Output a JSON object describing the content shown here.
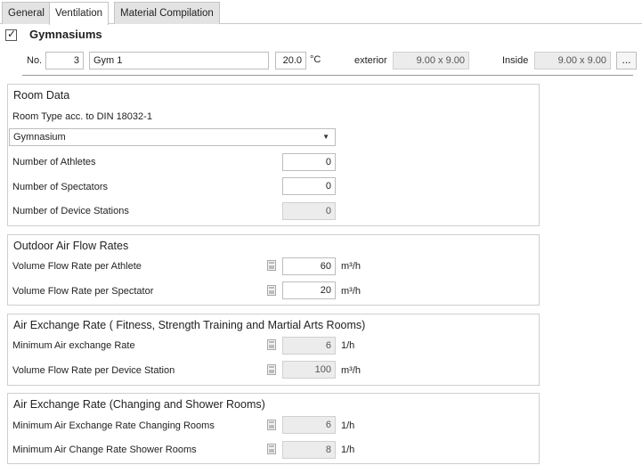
{
  "tabs": [
    {
      "label": "General"
    },
    {
      "label": "Ventilation"
    },
    {
      "label": "Material Compilation"
    }
  ],
  "header": {
    "checked": true,
    "title": "Gymnasiums",
    "no_label": "No.",
    "no_value": "3",
    "name_value": "Gym 1",
    "temp_value": "20.0",
    "temp_unit": "°C",
    "exterior_label": "exterior",
    "exterior_value": "9.00 x 9.00",
    "inside_label": "Inside",
    "inside_value": "9.00 x 9.00",
    "more_button": "..."
  },
  "room_data": {
    "title": "Room Data",
    "room_type_label": "Room Type acc. to DIN 18032-1",
    "room_type_value": "Gymnasium",
    "athletes_label": "Number of Athletes",
    "athletes_value": "0",
    "spectators_label": "Number of Spectators",
    "spectators_value": "0",
    "device_stations_label": "Number of Device Stations",
    "device_stations_value": "0"
  },
  "outdoor_air": {
    "title": "Outdoor Air Flow Rates",
    "athlete_label": "Volume Flow Rate per Athlete",
    "athlete_value": "60",
    "athlete_unit": "m³/h",
    "spectator_label": "Volume Flow Rate per Spectator",
    "spectator_value": "20",
    "spectator_unit": "m³/h"
  },
  "air_exchange_fitness": {
    "title": "Air Exchange Rate ( Fitness, Strength Training and Martial Arts Rooms)",
    "min_label": "Minimum Air exchange Rate",
    "min_value": "6",
    "min_unit": "1/h",
    "device_label": "Volume Flow Rate per Device Station",
    "device_value": "100",
    "device_unit": "m³/h"
  },
  "air_exchange_changing": {
    "title": "Air Exchange Rate (Changing and Shower Rooms)",
    "changing_label": "Minimum Air Exchange Rate Changing Rooms",
    "changing_value": "6",
    "changing_unit": "1/h",
    "shower_label": "Minimum Air Change Rate Shower Rooms",
    "shower_value": "8",
    "shower_unit": "1/h"
  },
  "icons": {
    "check": "check-icon",
    "dropdown": "chevron-down-icon",
    "calculator": "calculator-icon"
  }
}
